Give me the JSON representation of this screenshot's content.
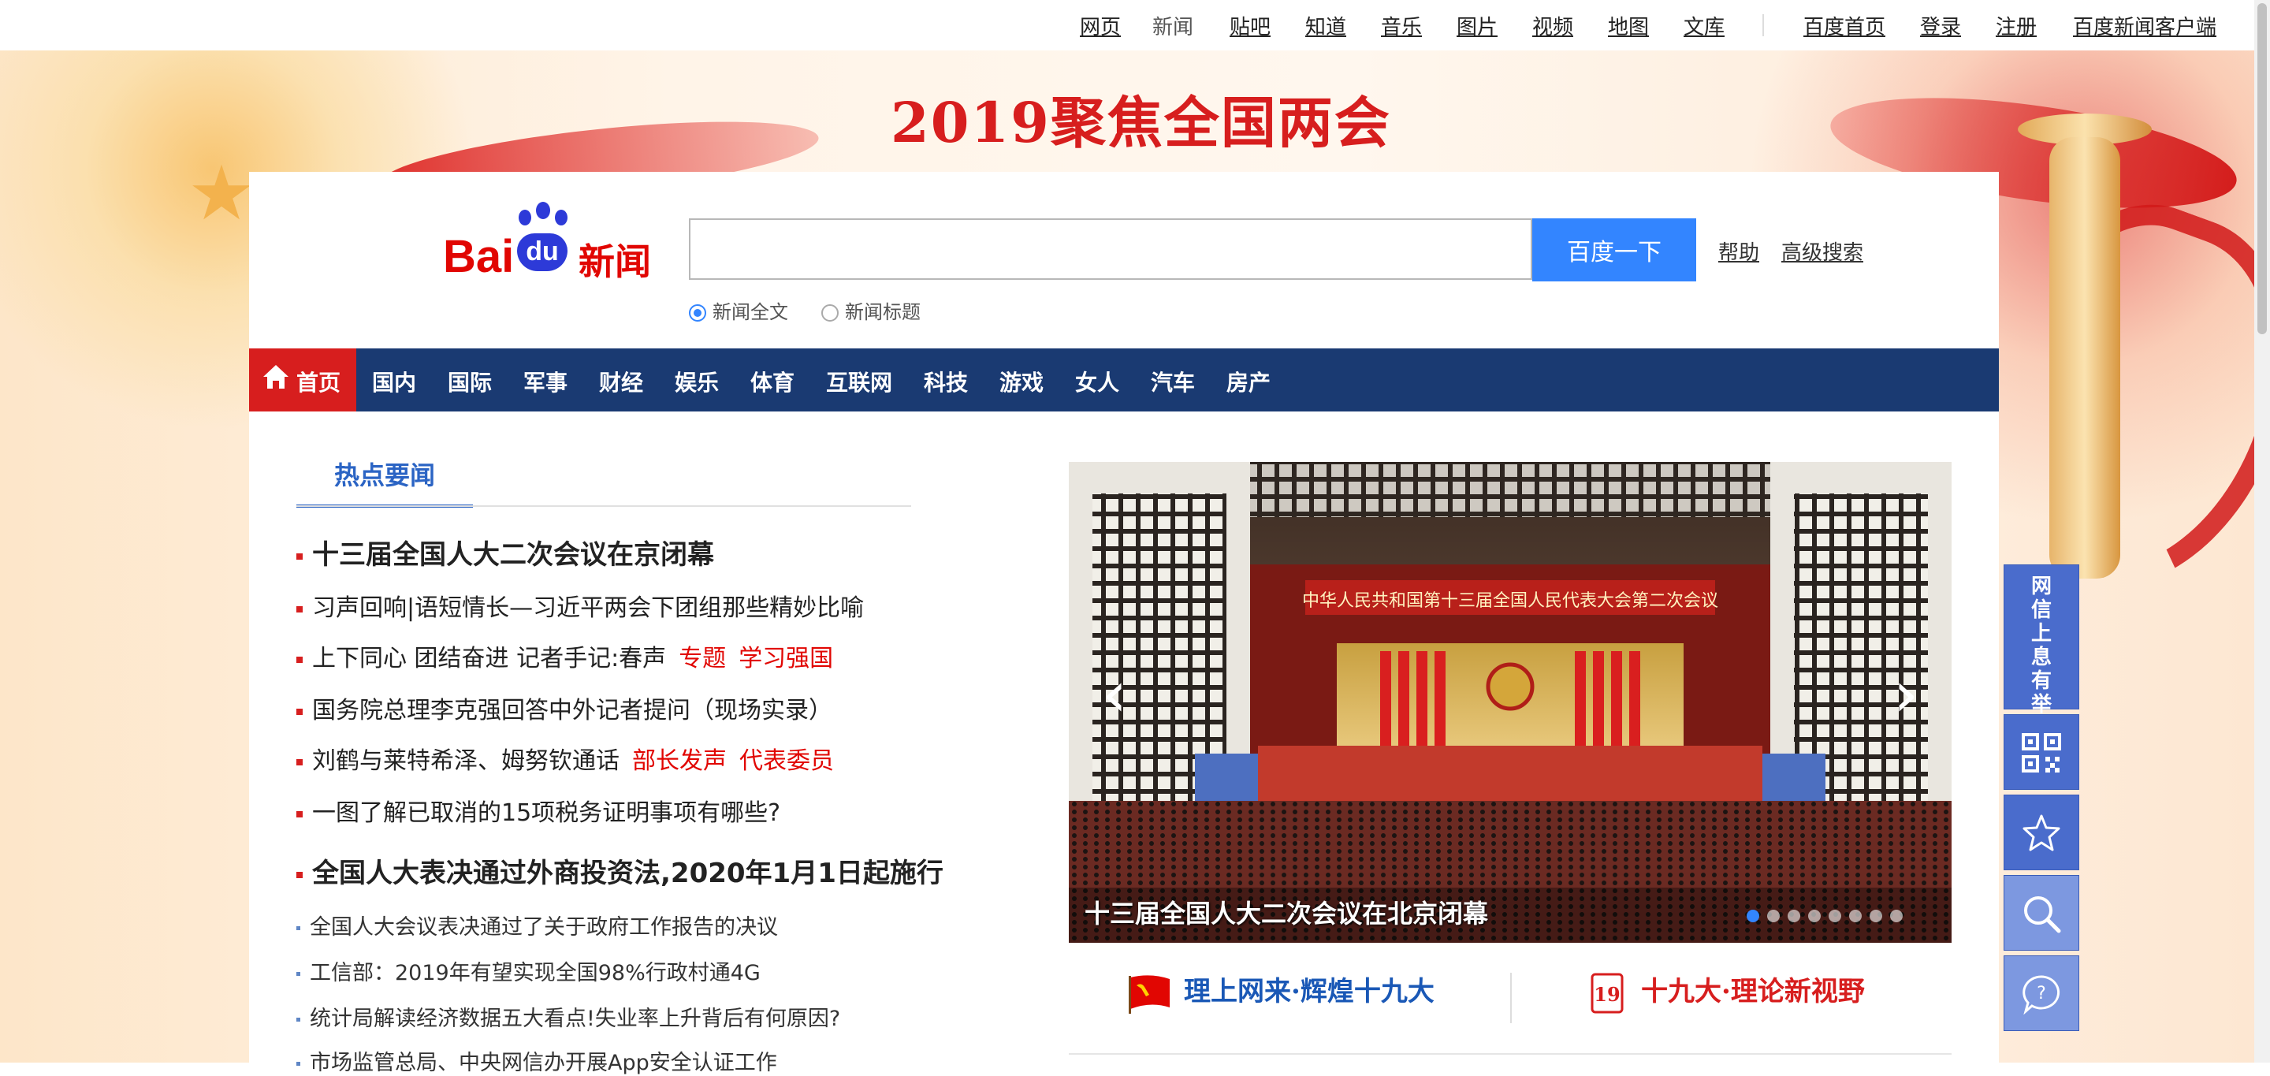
{
  "topnav": {
    "links": [
      "网页",
      "新闻",
      "贴吧",
      "知道",
      "音乐",
      "图片",
      "视频",
      "地图",
      "文库"
    ],
    "right": [
      "百度首页",
      "登录",
      "注册",
      "百度新闻客户端"
    ]
  },
  "banner": {
    "title": "2019聚焦全国两会"
  },
  "logo": {
    "bai": "Bai",
    "du": "du",
    "name": "新闻"
  },
  "search": {
    "value": "",
    "button": "百度一下",
    "help": "帮助",
    "advanced": "高级搜索",
    "options": [
      "新闻全文",
      "新闻标题"
    ],
    "selected": "新闻全文"
  },
  "channels": {
    "home": "首页",
    "items": [
      "国内",
      "国际",
      "军事",
      "财经",
      "娱乐",
      "体育",
      "互联网",
      "科技",
      "游戏",
      "女人",
      "汽车",
      "房产"
    ]
  },
  "hot": {
    "tab": "热点要闻",
    "headline1": "十三届全国人大二次会议在京闭幕",
    "line1": "习声回响|语短情长—习近平两会下团组那些精妙比喻",
    "line2": "上下同心 团结奋进 记者手记:春声",
    "line2_links": [
      "专题",
      "学习强国"
    ],
    "line3": "国务院总理李克强回答中外记者提问（现场实录）",
    "line4": "刘鹤与莱特希泽、姆努钦通话",
    "line4_links": [
      "部长发声",
      "代表委员"
    ],
    "line5": "一图了解已取消的15项税务证明事项有哪些?",
    "headline2": "全国人大表决通过外商投资法,2020年1月1日起施行",
    "sub": [
      "全国人大会议表决通过了关于政府工作报告的决议",
      "工信部：2019年有望实现全国98%行政村通4G",
      "统计局解读经济数据五大看点!失业率上升背后有何原因?",
      "市场监管总局、中央网信办开展App安全认证工作"
    ]
  },
  "slider": {
    "caption": "十三届全国人大二次会议在北京闭幕",
    "hall_banner": "中华人民共和国第十三届全国人民代表大会第二次会议",
    "prev": "‹",
    "next": "›",
    "dot_count": 8,
    "active_dot": 1
  },
  "promos": {
    "left": "理上网来·辉煌十九大",
    "right": "十九大·理论新视野",
    "badge": "19"
  },
  "tools": {
    "report": "网信上息有举害报"
  },
  "colors": {
    "brand_red": "#e10602",
    "channel_bar": "#1a3a72",
    "search_button": "#3385ff",
    "tool": "#4a6ccc"
  }
}
